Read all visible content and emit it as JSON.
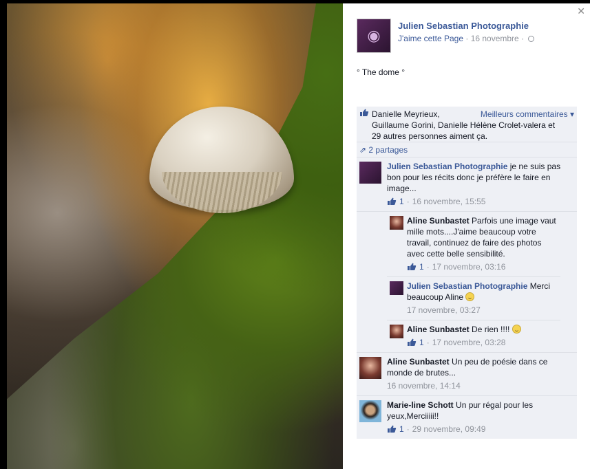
{
  "post": {
    "page_name": "Julien Sebastian Photographie",
    "like_page": "J'aime cette Page",
    "date": "16 novembre",
    "caption": "° The dome °"
  },
  "ufi": {
    "likes_line1": "Danielle Meyrieux,",
    "likes_rest": "Guillaume Gorini, Danielle Hélène Crolet-valera et 29 autres personnes aiment ça.",
    "best_comments": "Meilleurs commentaires",
    "shares": "2 partages"
  },
  "comments": [
    {
      "author": "Julien Sebastian Photographie",
      "text": "je ne suis pas bon pour les récits donc je préfère le faire en image...",
      "likes": "1",
      "time": "16 novembre, 15:55"
    },
    {
      "author": "Aline Sunbastet",
      "text": "Un peu de poésie dans ce monde de brutes...",
      "time": "16 novembre, 14:14"
    },
    {
      "author": "Marie-line Schott",
      "text": "Un pur régal pour les yeux,Merciiiii!!",
      "likes": "1",
      "time": "29 novembre, 09:49"
    }
  ],
  "replies": [
    {
      "author": "Aline Sunbastet",
      "text": "Parfois une image vaut mille mots....J'aime beaucoup votre travail, continuez de faire des photos avec cette belle sensibilité.",
      "likes": "1",
      "time": "17 novembre, 03:16"
    },
    {
      "author": "Julien Sebastian Photographie",
      "text": "Merci beaucoup Aline",
      "time": "17 novembre, 03:27"
    },
    {
      "author": "Aline Sunbastet",
      "text": "De rien !!!!",
      "likes": "1",
      "time": "17 novembre, 03:28"
    }
  ],
  "icons": {
    "close": "close-icon",
    "like": "thumbs-up-icon",
    "share": "share-arrow-icon",
    "globe": "globe-icon",
    "smile": "smiley-icon"
  },
  "colors": {
    "link": "#3b5998",
    "meta": "#90949c",
    "ufi_bg": "#eef0f5"
  }
}
